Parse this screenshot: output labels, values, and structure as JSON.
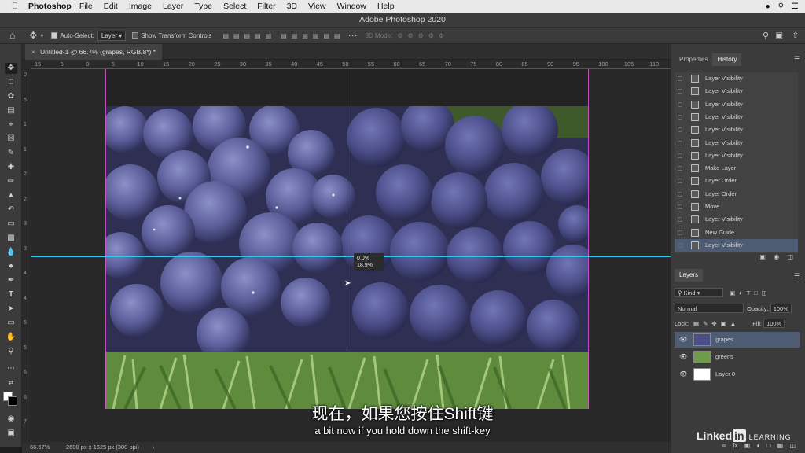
{
  "menubar": {
    "app_name": "Photoshop",
    "items": [
      "File",
      "Edit",
      "Image",
      "Layer",
      "Type",
      "Select",
      "Filter",
      "3D",
      "View",
      "Window",
      "Help"
    ]
  },
  "window": {
    "title": "Adobe Photoshop 2020"
  },
  "options_bar": {
    "auto_select_label": "Auto-Select:",
    "auto_select_value": "Layer",
    "show_transform_label": "Show Transform Controls",
    "three_d_mode_label": "3D Mode:"
  },
  "document": {
    "tab_title": "Untitled-1 @ 66.7% (grapes, RGB/8*) *",
    "ruler_top": [
      "15",
      "5",
      "0",
      "5",
      "10",
      "15",
      "20",
      "25",
      "30",
      "35",
      "40",
      "45",
      "50",
      "55",
      "60",
      "65",
      "70",
      "75",
      "80",
      "85",
      "90",
      "95",
      "100",
      "105",
      "110"
    ],
    "ruler_left": [
      "0",
      "5",
      "1",
      "1",
      "2",
      "2",
      "3",
      "3",
      "4",
      "4",
      "5",
      "5",
      "6",
      "6",
      "7"
    ],
    "hud_line1": "0.0%",
    "hud_line2": "18.9%"
  },
  "status": {
    "zoom": "66.67%",
    "doc_size": "2600 px x 1625 px (300 ppi)"
  },
  "subtitles": {
    "cn": "现在，如果您按住Shift键",
    "en": "a bit now if you hold down the shift-key"
  },
  "panels": {
    "tabs": [
      "Properties",
      "History"
    ],
    "active_tab": "History",
    "history": [
      "Layer Visibility",
      "Layer Visibility",
      "Layer Visibility",
      "Layer Visibility",
      "Layer Visibility",
      "Layer Visibility",
      "Layer Visibility",
      "Make Layer",
      "Layer Order",
      "Layer Order",
      "Move",
      "Layer Visibility",
      "New Guide",
      "Layer Visibility"
    ],
    "layers_title": "Layers",
    "kind_label": "Kind",
    "blend_mode": "Normal",
    "opacity_label": "Opacity:",
    "opacity_value": "100%",
    "lock_label": "Lock:",
    "fill_label": "Fill:",
    "fill_value": "100%",
    "layers": [
      "grapes",
      "greens",
      "Layer 0"
    ]
  },
  "watermark": {
    "linked": "Linked",
    "in": "in",
    "learning": "LEARNING"
  },
  "colors": {
    "guide_vertical": "#e05ad8",
    "guide_horizontal": "#33c7f2",
    "selection_row": "#4e5c73"
  }
}
